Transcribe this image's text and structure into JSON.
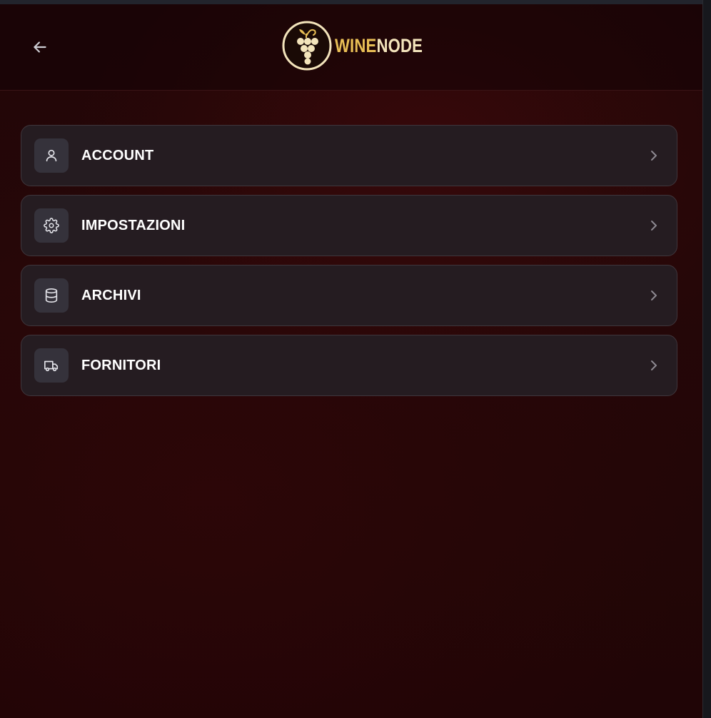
{
  "header": {
    "back_icon": "arrow-left-icon",
    "logo": {
      "word_wine": "WINE",
      "word_node": "NODE",
      "badge_icon": "grape-icon",
      "colors": {
        "gold": "#e8be55",
        "cream": "#f3e4bb"
      }
    }
  },
  "menu": {
    "items": [
      {
        "label": "ACCOUNT",
        "icon": "user-icon"
      },
      {
        "label": "IMPOSTAZIONI",
        "icon": "gear-icon"
      },
      {
        "label": "ARCHIVI",
        "icon": "database-icon"
      },
      {
        "label": "FORNITORI",
        "icon": "truck-icon"
      }
    ],
    "chevron_icon": "chevron-right-icon"
  },
  "colors": {
    "background": "#220607",
    "card": "#251c21",
    "card_border": "#3f363c",
    "icon_tile": "#35323b",
    "text": "#ffffff"
  }
}
